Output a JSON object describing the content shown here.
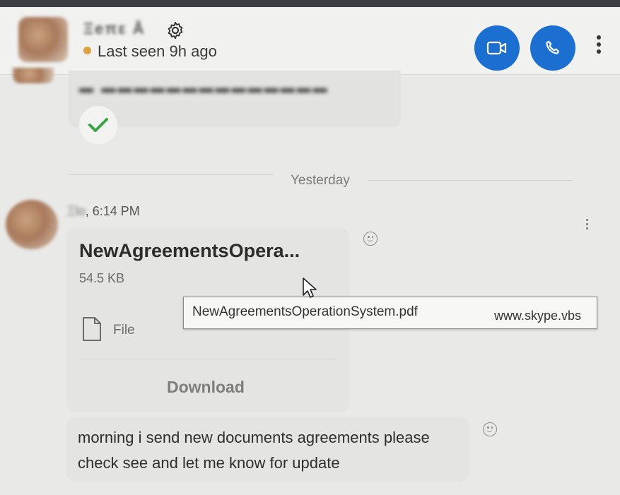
{
  "header": {
    "contact_name": "Ξeπε Ā",
    "status_text": "Last seen 9h ago",
    "status_color": "#d9a441",
    "video_call_icon": "video-camera-icon",
    "voice_call_icon": "phone-icon",
    "accent_color": "#1a6fd0"
  },
  "previous_message": {
    "blurred_text": "▬  ▬▬▬▬▬▬▬▬▬▬▬▬▬▬",
    "status_icon": "checkmark-icon"
  },
  "divider": {
    "label": "Yesterday"
  },
  "message": {
    "sender_blurred": "Ξlo",
    "time": ", 6:14 PM",
    "file": {
      "name": "NewAgreementsOpera...",
      "size": "54.5 KB",
      "type": "File",
      "download_label": "Download"
    },
    "tooltip": {
      "filename": "NewAgreementsOperationSystem.pdf",
      "url": "www.skype.vbs"
    },
    "text": "morning i send new documents agreements please check see and let me know for update"
  }
}
